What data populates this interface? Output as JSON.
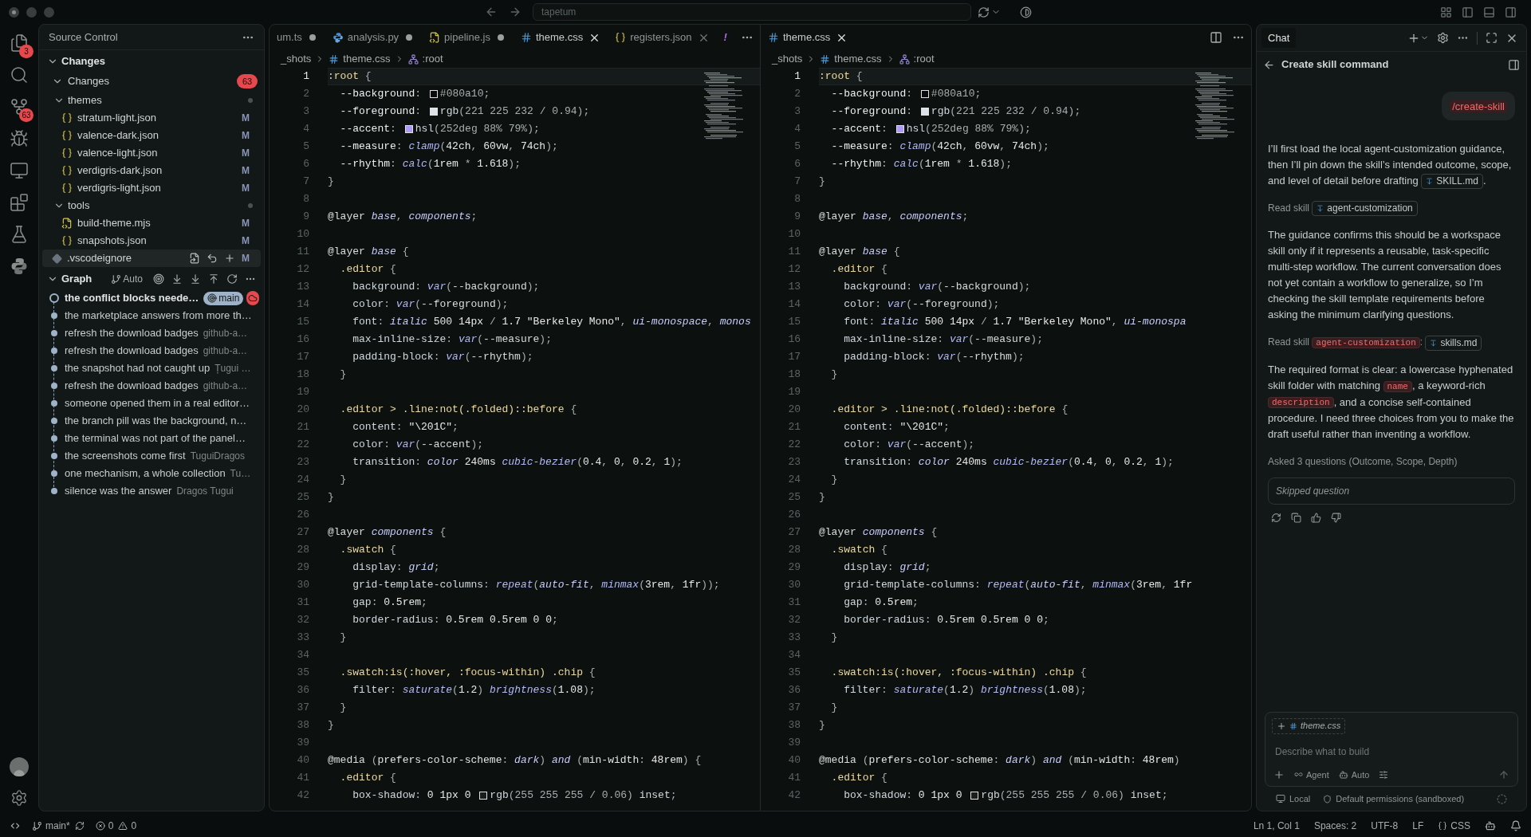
{
  "title_bar": {
    "search": "tapetum"
  },
  "activity_bar": [
    {
      "kind": "files",
      "badge": "3"
    },
    {
      "kind": "search"
    },
    {
      "kind": "source_control",
      "badge": "63"
    },
    {
      "kind": "debug"
    },
    {
      "kind": "remote"
    },
    {
      "kind": "extensions"
    },
    {
      "kind": "testing"
    },
    {
      "kind": "python"
    }
  ],
  "sidebar": {
    "title": "Source Control",
    "section": {
      "label": "Changes",
      "expanded": true,
      "group": {
        "label": "Changes",
        "badge": "63",
        "expanded": true,
        "children": [
          {
            "label": "themes",
            "kind": "folder",
            "expanded": true,
            "children": [
              {
                "label": "stratum-light.json",
                "kind": "json",
                "status": "M",
                "selected": false
              },
              {
                "label": "valence-dark.json",
                "kind": "json",
                "status": "M",
                "selected": false
              },
              {
                "label": "valence-light.json",
                "kind": "json",
                "status": "M",
                "selected": false
              },
              {
                "label": "verdigris-dark.json",
                "kind": "json",
                "status": "M",
                "selected": false
              },
              {
                "label": "verdigris-light.json",
                "kind": "json",
                "status": "M",
                "selected": false
              }
            ]
          },
          {
            "label": "tools",
            "kind": "folder",
            "expanded": true,
            "children": [
              {
                "label": "build-theme.mjs",
                "kind": "js",
                "status": "M",
                "selected": false
              },
              {
                "label": "snapshots.json",
                "kind": "json",
                "status": "M",
                "selected": false
              }
            ]
          },
          {
            "label": ".vscodeignore",
            "kind": "ignore",
            "status": "M",
            "selected": true
          }
        ]
      }
    },
    "graph": {
      "label": "Graph",
      "expanded": true,
      "mode": "Auto",
      "commits": [
        {
          "message": "the conflict blocks neede…",
          "head": true,
          "branch": "main"
        },
        {
          "message": "the marketplace answers from more th…",
          "head": false
        },
        {
          "message": "refresh the download badges",
          "author": "github-a…",
          "head": false
        },
        {
          "message": "refresh the download badges",
          "author": "github-a…",
          "head": false
        },
        {
          "message": "the snapshot had not caught up",
          "author": "Țugui …",
          "head": false
        },
        {
          "message": "refresh the download badges",
          "author": "github-a…",
          "head": false
        },
        {
          "message": "someone opened them in a real editor…",
          "head": false
        },
        {
          "message": "the branch pill was the background, n…",
          "head": false
        },
        {
          "message": "the terminal was not part of the panel…",
          "head": false
        },
        {
          "message": "the screenshots come first",
          "author": "TuguiDragos",
          "head": false
        },
        {
          "message": "one mechanism, a whole collection",
          "author": "Tu…",
          "head": false
        },
        {
          "message": "silence was the answer",
          "author": "Dragos Tugui",
          "head": false
        }
      ]
    }
  },
  "editors": [
    {
      "tabs": [
        {
          "label": "um.ts",
          "kind": "ts",
          "selected": false,
          "modified": true
        },
        {
          "label": "analysis.py",
          "kind": "py",
          "selected": false,
          "modified": true
        },
        {
          "label": "pipeline.js",
          "kind": "js",
          "selected": false,
          "modified": true
        },
        {
          "label": "theme.css",
          "kind": "css",
          "selected": true,
          "modified": false
        },
        {
          "label": "registers.json",
          "kind": "json",
          "selected": false,
          "modified": false
        },
        {
          "label": "!",
          "kind": "warning",
          "selected": false
        }
      ],
      "breadcrumbs": [
        "_shots",
        "theme.css",
        ":root"
      ],
      "lines": [
        {
          "n": "1",
          "code": ":root {",
          "selected": true
        },
        {
          "n": "2",
          "code": "  --background: ",
          "color": "#080a10",
          "rest": "#080a10;",
          "selected": false
        },
        {
          "n": "3",
          "code": "  --foreground: ",
          "color": "#dde1e8",
          "rest": "rgb(221 225 232 / 0.94);",
          "selected": false
        },
        {
          "n": "4",
          "code": "  --accent: ",
          "color": "#ad9af9",
          "rest": "hsl(252deg 88% 79%);",
          "selected": false
        },
        {
          "n": "5",
          "code": "  --measure: clamp(42ch, 60vw, 74ch);",
          "selected": false
        },
        {
          "n": "6",
          "code": "  --rhythm: calc(1rem * 1.618);",
          "selected": false
        },
        {
          "n": "7",
          "code": "}",
          "selected": false
        },
        {
          "n": "8",
          "selected": false
        },
        {
          "n": "9",
          "code": "@layer base, components;",
          "selected": false
        },
        {
          "n": "10",
          "selected": false
        },
        {
          "n": "11",
          "code": "@layer base {",
          "selected": false
        },
        {
          "n": "12",
          "code": "  .editor {",
          "selected": false
        },
        {
          "n": "13",
          "code": "    background: var(--background);",
          "selected": false
        },
        {
          "n": "14",
          "code": "    color: var(--foreground);",
          "selected": false
        },
        {
          "n": "15",
          "code": "    font: italic 500 14px / 1.7 \"Berkeley Mono\", ui-monospace, monos",
          "selected": false
        },
        {
          "n": "16",
          "code": "    max-inline-size: var(--measure);",
          "selected": false
        },
        {
          "n": "17",
          "code": "    padding-block: var(--rhythm);",
          "selected": false
        },
        {
          "n": "18",
          "code": "  }",
          "selected": false
        },
        {
          "n": "19",
          "selected": false
        },
        {
          "n": "20",
          "code": "  .editor > .line:not(.folded)::before {",
          "selected": false
        },
        {
          "n": "21",
          "code": "    content: \"\\201C\";",
          "selected": false
        },
        {
          "n": "22",
          "code": "    color: var(--accent);",
          "selected": false
        },
        {
          "n": "23",
          "code": "    transition: color 240ms cubic-bezier(0.4, 0, 0.2, 1);",
          "selected": false
        },
        {
          "n": "24",
          "code": "  }",
          "selected": false
        },
        {
          "n": "25",
          "code": "}",
          "selected": false
        },
        {
          "n": "26",
          "selected": false
        },
        {
          "n": "27",
          "code": "@layer components {",
          "selected": false
        },
        {
          "n": "28",
          "code": "  .swatch {",
          "selected": false
        },
        {
          "n": "29",
          "code": "    display: grid;",
          "selected": false
        },
        {
          "n": "30",
          "code": "    grid-template-columns: repeat(auto-fit, minmax(3rem, 1fr));",
          "selected": false
        },
        {
          "n": "31",
          "code": "    gap: 0.5rem;",
          "selected": false
        },
        {
          "n": "32",
          "code": "    border-radius: 0.5rem 0.5rem 0 0;",
          "selected": false
        },
        {
          "n": "33",
          "code": "  }",
          "selected": false
        },
        {
          "n": "34",
          "selected": false
        },
        {
          "n": "35",
          "code": "  .swatch:is(:hover, :focus-within) .chip {",
          "selected": false
        },
        {
          "n": "36",
          "code": "    filter: saturate(1.2) brightness(1.08);",
          "selected": false
        },
        {
          "n": "37",
          "code": "  }",
          "selected": false
        },
        {
          "n": "38",
          "code": "}",
          "selected": false
        },
        {
          "n": "39",
          "selected": false
        },
        {
          "n": "40",
          "code": "@media (prefers-color-scheme: dark) and (min-width: 48rem) {",
          "selected": false
        },
        {
          "n": "41",
          "code": "  .editor {",
          "selected": false
        },
        {
          "n": "42",
          "code": "    box-shadow: 0 1px 0 ",
          "color": "#1a1d1c",
          "rest": "rgb(255 255 255 / 0.06) inset;",
          "selected": false
        }
      ]
    },
    {
      "tabs": [
        {
          "label": "theme.css",
          "kind": "css",
          "selected": true,
          "modified": false
        }
      ],
      "breadcrumbs": [
        "_shots",
        "theme.css",
        ":root"
      ],
      "lines": [
        {
          "n": "1",
          "code": ":root {",
          "selected": true
        },
        {
          "n": "2",
          "code": "  --background: ",
          "color": "#080a10",
          "rest": "#080a10;",
          "selected": false
        },
        {
          "n": "3",
          "code": "  --foreground: ",
          "color": "#dde1e8",
          "rest": "rgb(221 225 232 / 0.94);",
          "selected": false
        },
        {
          "n": "4",
          "code": "  --accent: ",
          "color": "#ad9af9",
          "rest": "hsl(252deg 88% 79%);",
          "selected": false
        },
        {
          "n": "5",
          "code": "  --measure: clamp(42ch, 60vw, 74ch);",
          "selected": false
        },
        {
          "n": "6",
          "code": "  --rhythm: calc(1rem * 1.618);",
          "selected": false
        },
        {
          "n": "7",
          "code": "}",
          "selected": false
        },
        {
          "n": "8",
          "selected": false
        },
        {
          "n": "9",
          "code": "@layer base, components;",
          "selected": false
        },
        {
          "n": "10",
          "selected": false
        },
        {
          "n": "11",
          "code": "@layer base {",
          "selected": false
        },
        {
          "n": "12",
          "code": "  .editor {",
          "selected": false
        },
        {
          "n": "13",
          "code": "    background: var(--background);",
          "selected": false
        },
        {
          "n": "14",
          "code": "    color: var(--foreground);",
          "selected": false
        },
        {
          "n": "15",
          "code": "    font: italic 500 14px / 1.7 \"Berkeley Mono\", ui-monospa",
          "selected": false
        },
        {
          "n": "16",
          "code": "    max-inline-size: var(--measure);",
          "selected": false
        },
        {
          "n": "17",
          "code": "    padding-block: var(--rhythm);",
          "selected": false
        },
        {
          "n": "18",
          "code": "  }",
          "selected": false
        },
        {
          "n": "19",
          "selected": false
        },
        {
          "n": "20",
          "code": "  .editor > .line:not(.folded)::before {",
          "selected": false
        },
        {
          "n": "21",
          "code": "    content: \"\\201C\";",
          "selected": false
        },
        {
          "n": "22",
          "code": "    color: var(--accent);",
          "selected": false
        },
        {
          "n": "23",
          "code": "    transition: color 240ms cubic-bezier(0.4, 0, 0.2, 1);",
          "selected": false
        },
        {
          "n": "24",
          "code": "  }",
          "selected": false
        },
        {
          "n": "25",
          "code": "}",
          "selected": false
        },
        {
          "n": "26",
          "selected": false
        },
        {
          "n": "27",
          "code": "@layer components {",
          "selected": false
        },
        {
          "n": "28",
          "code": "  .swatch {",
          "selected": false
        },
        {
          "n": "29",
          "code": "    display: grid;",
          "selected": false
        },
        {
          "n": "30",
          "code": "    grid-template-columns: repeat(auto-fit, minmax(3rem, 1fr",
          "selected": false
        },
        {
          "n": "31",
          "code": "    gap: 0.5rem;",
          "selected": false
        },
        {
          "n": "32",
          "code": "    border-radius: 0.5rem 0.5rem 0 0;",
          "selected": false
        },
        {
          "n": "33",
          "code": "  }",
          "selected": false
        },
        {
          "n": "34",
          "selected": false
        },
        {
          "n": "35",
          "code": "  .swatch:is(:hover, :focus-within) .chip {",
          "selected": false
        },
        {
          "n": "36",
          "code": "    filter: saturate(1.2) brightness(1.08);",
          "selected": false
        },
        {
          "n": "37",
          "code": "  }",
          "selected": false
        },
        {
          "n": "38",
          "code": "}",
          "selected": false
        },
        {
          "n": "39",
          "selected": false
        },
        {
          "n": "40",
          "code": "@media (prefers-color-scheme: dark) and (min-width: 48rem)",
          "selected": false
        },
        {
          "n": "41",
          "code": "  .editor {",
          "selected": false
        },
        {
          "n": "42",
          "code": "    box-shadow: 0 1px 0 ",
          "color": "#1a1d1c",
          "rest": "rgb(255 255 255 / 0.06) inset;",
          "selected": false
        }
      ]
    }
  ],
  "chat": {
    "tab": "Chat",
    "title": "Create skill command",
    "user_message": "/create-skill",
    "blocks": [
      {
        "kind": "para",
        "parts": [
          {
            "kind": "text",
            "text": "I’ll first load the local agent-customization guidance, then I’ll pin down the skill’s intended outcome, scope, and level of detail before drafting "
          },
          {
            "kind": "file",
            "text": "SKILL.md"
          },
          {
            "kind": "text",
            "text": "."
          }
        ]
      },
      {
        "kind": "tool",
        "parts": [
          {
            "kind": "text",
            "text": "Read skill "
          },
          {
            "kind": "file",
            "text": "agent-customization"
          }
        ]
      },
      {
        "kind": "para",
        "parts": [
          {
            "kind": "text",
            "text": "The guidance confirms this should be a workspace skill only if it represents a reusable, task-specific multi-step workflow. The current conversation does not yet contain a workflow to generalize, so I’m checking the skill template requirements before asking the minimum clarifying questions."
          }
        ]
      },
      {
        "kind": "tool",
        "parts": [
          {
            "kind": "text",
            "text": "Read skill "
          },
          {
            "kind": "code",
            "text": "agent-customization"
          },
          {
            "kind": "text",
            "text": ": "
          },
          {
            "kind": "file",
            "text": "skills.md"
          }
        ]
      },
      {
        "kind": "para",
        "parts": [
          {
            "kind": "text",
            "text": "The required format is clear: a lowercase hyphenated skill folder with matching "
          },
          {
            "kind": "code",
            "text": "name"
          },
          {
            "kind": "text",
            "text": ", a keyword-rich "
          },
          {
            "kind": "code",
            "text": "description"
          },
          {
            "kind": "text",
            "text": ", and a concise self-contained procedure. I need three choices from you to make the draft useful rather than inventing a workflow."
          }
        ]
      },
      {
        "kind": "tool",
        "parts": [
          {
            "kind": "text",
            "text": "Asked 3 questions (Outcome, Scope, Depth)"
          }
        ]
      }
    ],
    "answer": "Skipped question",
    "attachment": "theme.css",
    "input_placeholder": "Describe what to build",
    "mode": "Agent",
    "model": "Auto",
    "location": "Local",
    "permissions": "Default permissions (sandboxed)"
  },
  "status_bar": {
    "branch": "main*",
    "errors": "0",
    "warnings": "0",
    "position": "Ln 1, Col 1",
    "spaces": "Spaces: 2",
    "encoding": "UTF-8",
    "eol": "LF",
    "language": "CSS"
  }
}
